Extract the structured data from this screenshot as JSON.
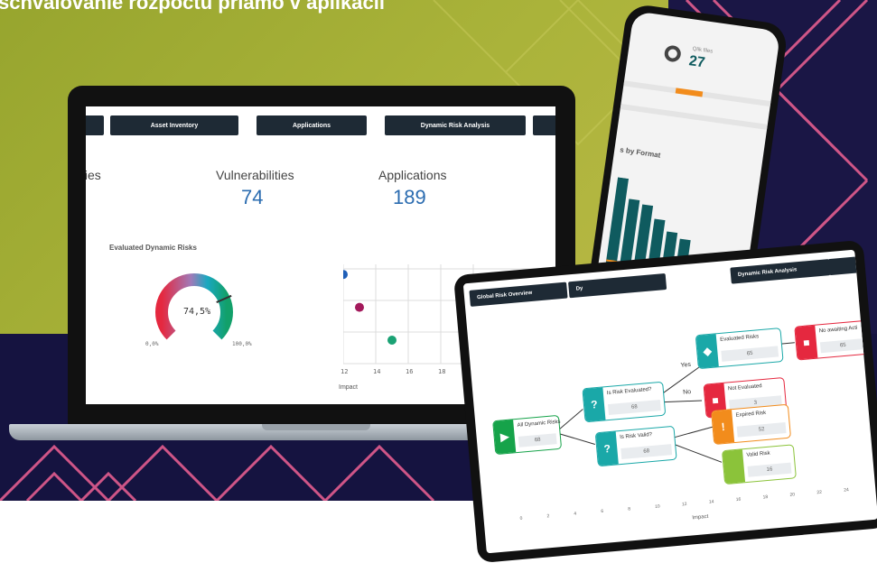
{
  "banner": {
    "title": "schvalovanie rozpočtu priamo v aplikácii"
  },
  "laptop": {
    "tabs": [
      "Asset Inventory",
      "Applications",
      "Dynamic Risk Analysis"
    ],
    "kpis": [
      {
        "label": "ties"
      },
      {
        "label": "Vulnerabilities",
        "value": "74"
      },
      {
        "label": "Applications",
        "value": "189"
      }
    ],
    "gauge": {
      "title": "Evaluated Dynamic Risks",
      "value": "74,5%",
      "min": "0,0%",
      "max": "100,0%",
      "fraction": 0.745
    },
    "scatter": {
      "ticks": [
        "12",
        "14",
        "16",
        "18"
      ],
      "xlabel": "Impact",
      "points": [
        {
          "x": 12,
          "y": 3.8,
          "color": "#1f5fb8"
        },
        {
          "x": 13,
          "y": 2.4,
          "color": "#a3195b"
        },
        {
          "x": 15,
          "y": 1.0,
          "color": "#1aa274"
        }
      ]
    }
  },
  "phone": {
    "kpi_label": "Qlik files",
    "kpi_value": "27",
    "chart_title": "s by Format",
    "bars": [
      1.0,
      0.78,
      0.74,
      0.6,
      0.48,
      0.42,
      0.26,
      0.18,
      0.12,
      0.08
    ]
  },
  "tablet": {
    "tabs": [
      "Global Risk Overview",
      "Dy",
      "Dynamic Risk Analysis"
    ],
    "nodes": {
      "all": {
        "label": "All Dynamic Risks",
        "count": "68"
      },
      "evaluated_q": {
        "label": "Is Risk Evaluated?",
        "count": "68"
      },
      "valid_q": {
        "label": "Is Risk Valid?",
        "count": "68"
      },
      "evaluated": {
        "label": "Evaluated Risks",
        "count": "65"
      },
      "not_evaluated": {
        "label": "Not Evaluated",
        "count": "3"
      },
      "no_action": {
        "label": "No awaiting Acti",
        "count": "65"
      },
      "expired": {
        "label": "Expired Risk",
        "count": "52"
      },
      "valid": {
        "label": "Valid Risk",
        "count": "16"
      }
    },
    "edge_yes": "Yes",
    "edge_no": "No",
    "axis_ticks": [
      "0",
      "2",
      "4",
      "6",
      "8",
      "10",
      "12",
      "14",
      "16",
      "18",
      "20",
      "22",
      "24"
    ],
    "xlabel": "Impact"
  },
  "colors": {
    "olive": "#a2ae36",
    "navy": "#1a1645",
    "pattern": "#e35d8f",
    "teal": "#1aa8a8",
    "dark_teal": "#0f5b5f",
    "orange": "#f28c1c",
    "red": "#e5283f",
    "lime": "#8bc33a",
    "green": "#16a34a"
  }
}
